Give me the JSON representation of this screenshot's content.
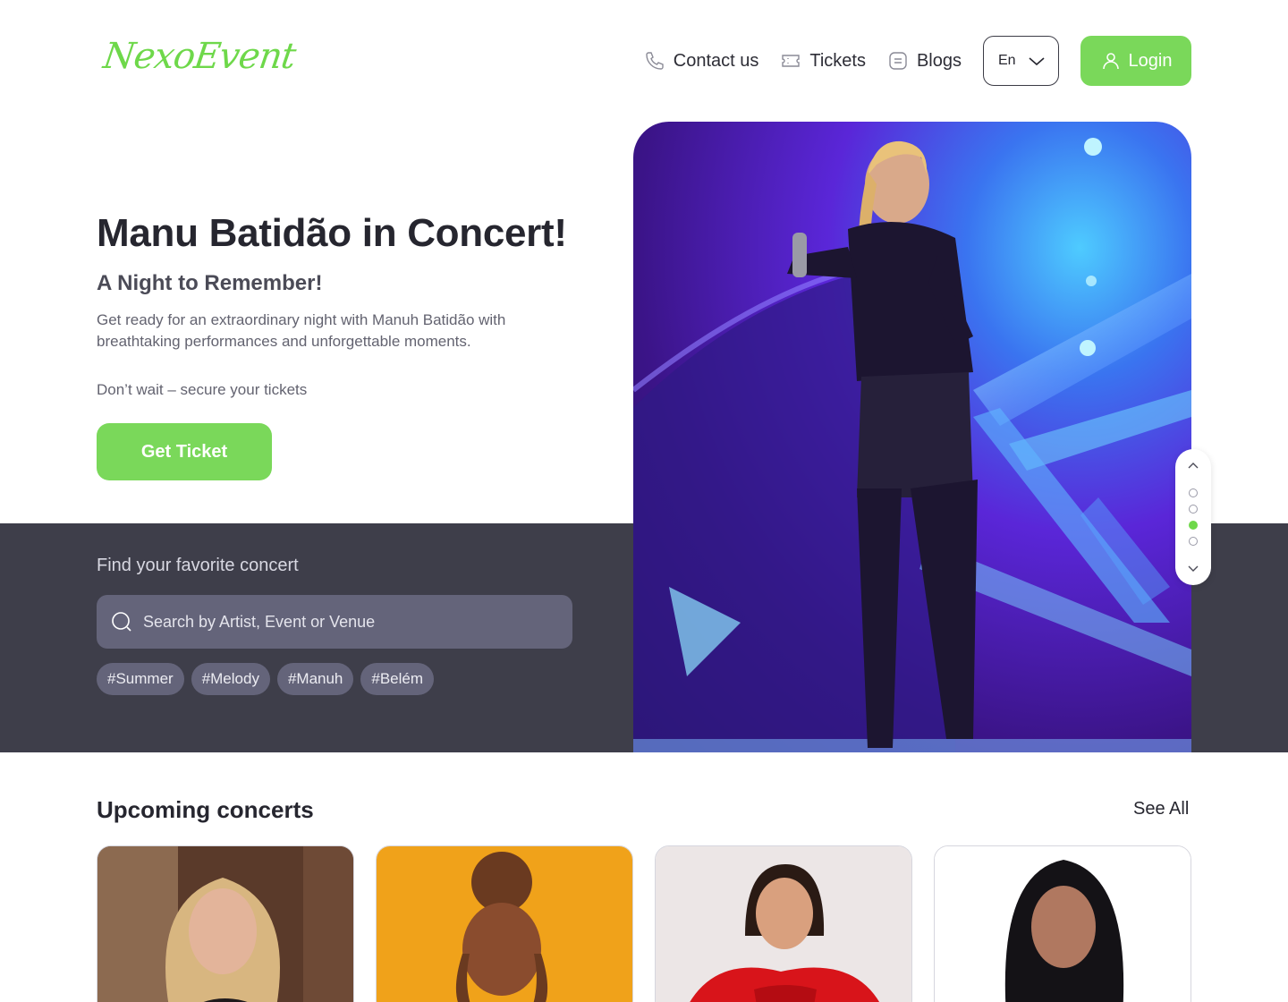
{
  "header": {
    "logo": "NexoEvent",
    "nav": {
      "contact": "Contact us",
      "tickets": "Tickets",
      "blogs": "Blogs"
    },
    "language": "En",
    "login": "Login"
  },
  "hero": {
    "title": "Manu Batidão in Concert!",
    "subtitle": "A Night to Remember!",
    "description": "Get ready for an extraordinary night with Manuh Batidão with breathtaking performances and unforgettable moments.",
    "cta_text": "Don’t wait – secure your tickets",
    "button": "Get Ticket"
  },
  "search": {
    "label": "Find your favorite concert",
    "placeholder": "Search by Artist, Event or Venue",
    "tags": [
      "#Summer",
      "#Melody",
      "#Manuh",
      "#Belém"
    ]
  },
  "carousel": {
    "slides": 4,
    "active_index": 2
  },
  "upcoming": {
    "title": "Upcoming concerts",
    "see_all": "See All"
  },
  "colors": {
    "accent": "#7ad85a",
    "band": "#3e3e4a",
    "input": "#64647a"
  }
}
